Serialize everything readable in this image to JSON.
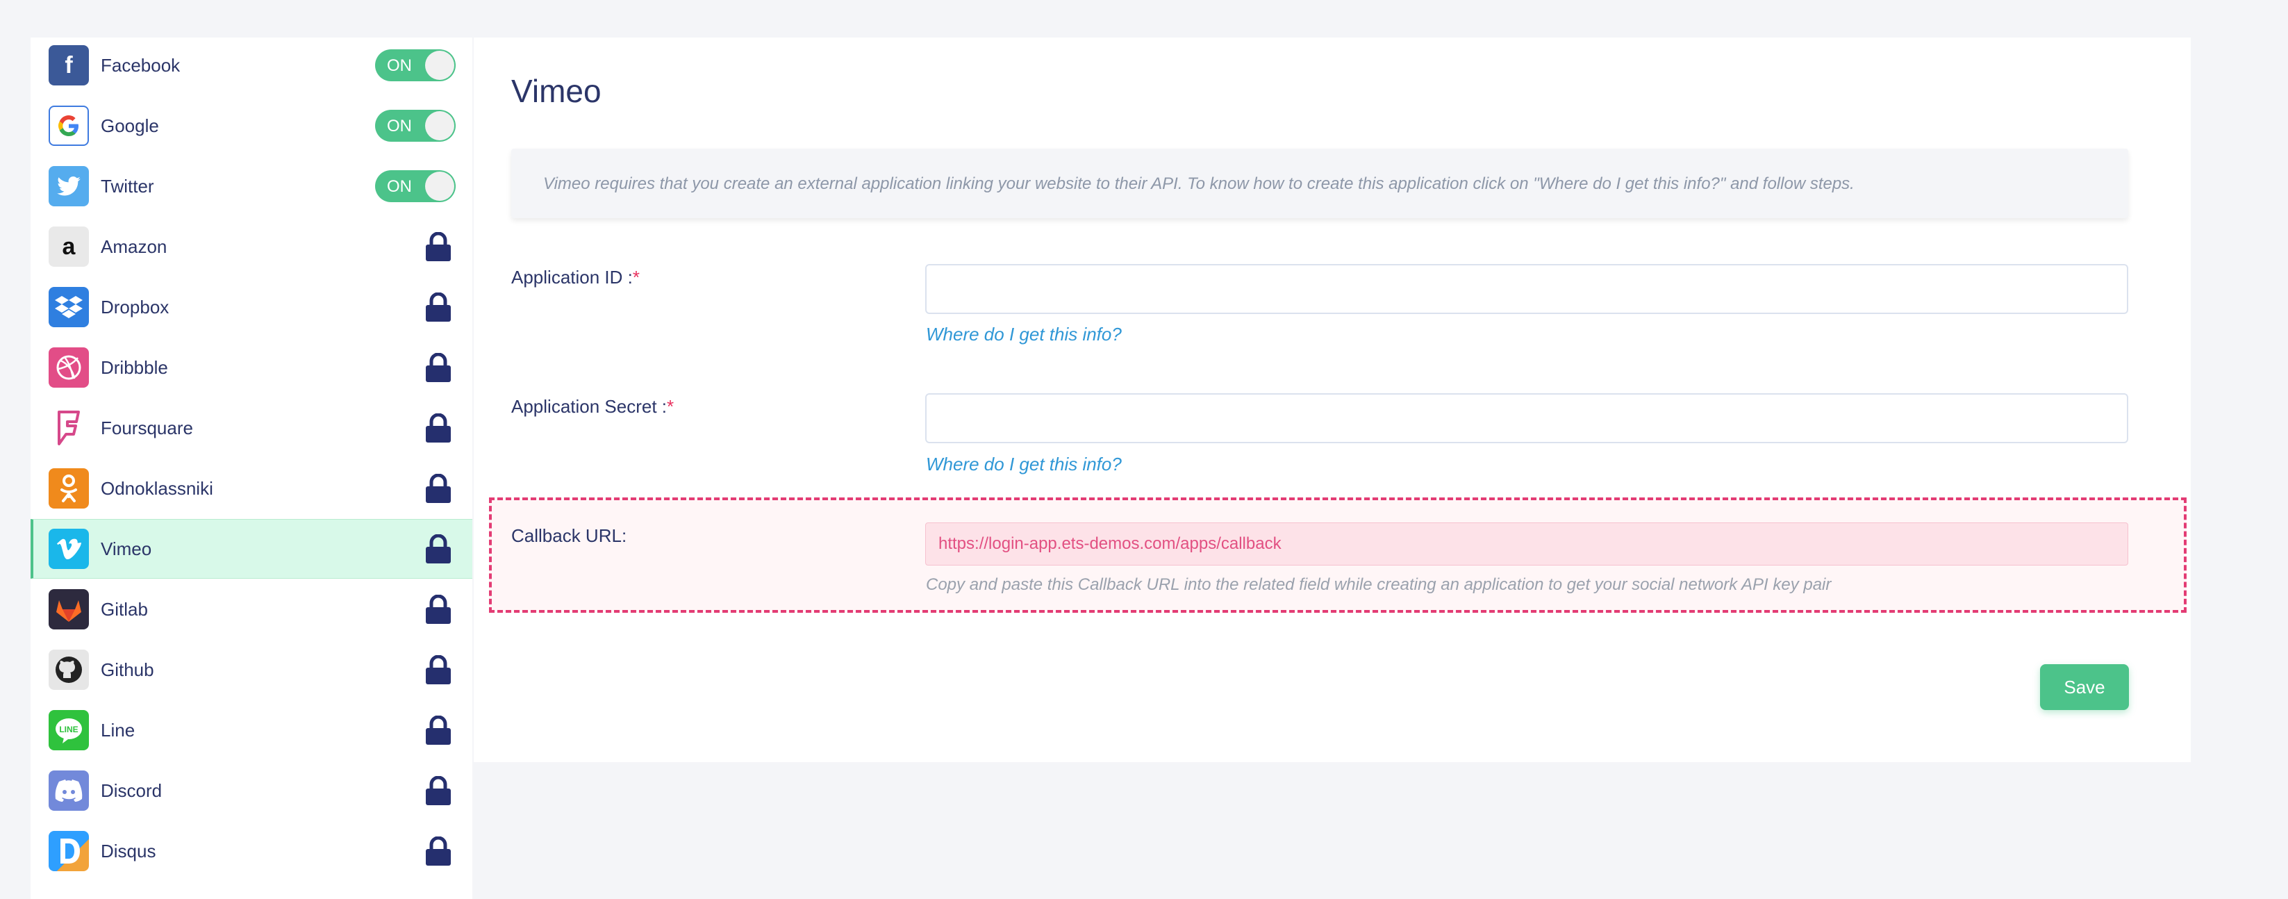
{
  "sidebar": {
    "items": [
      {
        "label": "Facebook",
        "state": "ON",
        "icon": "facebook-icon"
      },
      {
        "label": "Google",
        "state": "ON",
        "icon": "google-icon"
      },
      {
        "label": "Twitter",
        "state": "ON",
        "icon": "twitter-icon"
      },
      {
        "label": "Amazon",
        "state": "locked",
        "icon": "amazon-icon"
      },
      {
        "label": "Dropbox",
        "state": "locked",
        "icon": "dropbox-icon"
      },
      {
        "label": "Dribbble",
        "state": "locked",
        "icon": "dribbble-icon"
      },
      {
        "label": "Foursquare",
        "state": "locked",
        "icon": "foursquare-icon"
      },
      {
        "label": "Odnoklassniki",
        "state": "locked",
        "icon": "odnoklassniki-icon"
      },
      {
        "label": "Vimeo",
        "state": "locked",
        "icon": "vimeo-icon",
        "active": true
      },
      {
        "label": "Gitlab",
        "state": "locked",
        "icon": "gitlab-icon"
      },
      {
        "label": "Github",
        "state": "locked",
        "icon": "github-icon"
      },
      {
        "label": "Line",
        "state": "locked",
        "icon": "line-icon"
      },
      {
        "label": "Discord",
        "state": "locked",
        "icon": "discord-icon"
      },
      {
        "label": "Disqus",
        "state": "locked",
        "icon": "disqus-icon"
      }
    ]
  },
  "main": {
    "title": "Vimeo",
    "notice": "Vimeo requires that you create an external application linking your website to their API. To know how to create this application click on \"Where do I get this info?\" and follow steps.",
    "fields": {
      "app_id_label": "Application ID :",
      "app_secret_label": "Application Secret :",
      "required_mark": "*",
      "help_link": "Where do I get this info?",
      "callback_label": "Callback URL:",
      "callback_value": "https://login-app.ets-demos.com/apps/callback",
      "callback_help": "Copy and paste this Callback URL into the related field while creating an application to get your social network API key pair"
    },
    "save_label": "Save"
  },
  "colors": {
    "accent": "#4cc38a",
    "link": "#2f97d6",
    "required": "#e8325f",
    "highlight_border": "#e33c74",
    "lock": "#252f6e"
  }
}
